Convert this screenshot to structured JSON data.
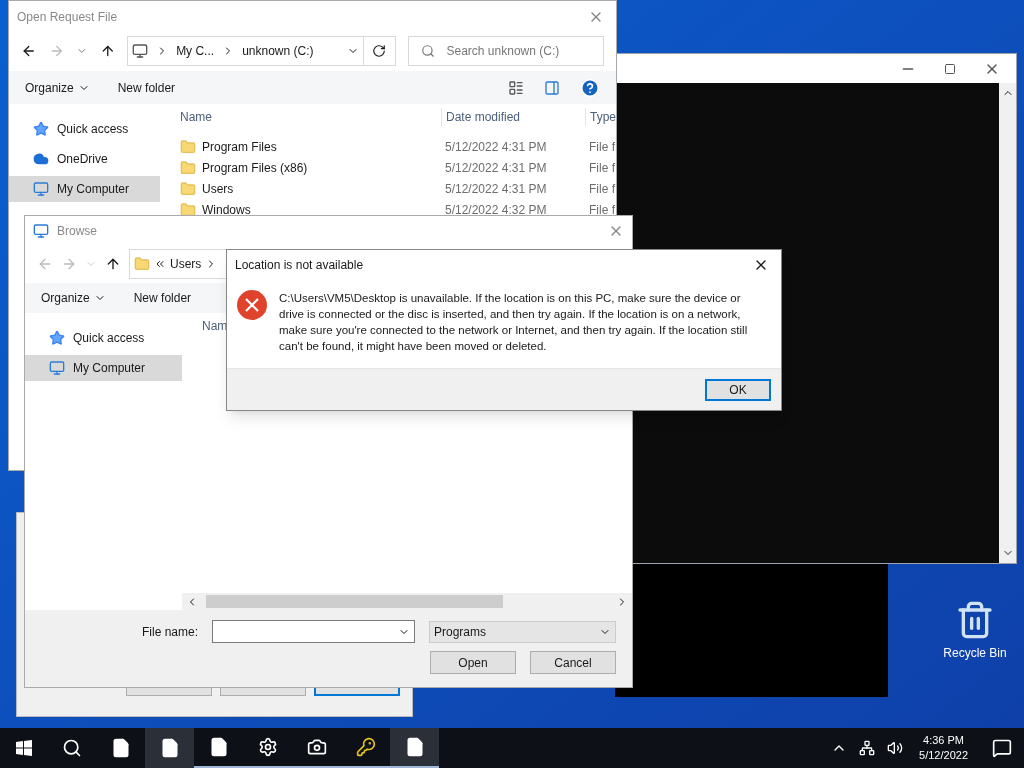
{
  "open_request_window": {
    "title": "Open Request File",
    "breadcrumb": [
      "My C...",
      "unknown (C:)"
    ],
    "search_placeholder": "Search unknown (C:)",
    "toolbar": [
      "Organize",
      "New folder"
    ],
    "sidebar": [
      {
        "label": "Quick access",
        "kind": "star",
        "selected": false
      },
      {
        "label": "OneDrive",
        "kind": "cloud",
        "selected": false
      },
      {
        "label": "My Computer",
        "kind": "computer",
        "selected": true
      }
    ],
    "columns": [
      "Name",
      "Date modified",
      "Type"
    ],
    "rows": [
      {
        "name": "Program Files",
        "date": "5/12/2022 4:31 PM",
        "type": "File f"
      },
      {
        "name": "Program Files (x86)",
        "date": "5/12/2022 4:31 PM",
        "type": "File f"
      },
      {
        "name": "Users",
        "date": "5/12/2022 4:31 PM",
        "type": "File f"
      },
      {
        "name": "Windows",
        "date": "5/12/2022 4:32 PM",
        "type": "File f"
      }
    ]
  },
  "back_dialog": {
    "buttons": [
      {
        "focused": false
      },
      {
        "focused": false
      },
      {
        "focused": true
      }
    ]
  },
  "browse_window": {
    "title": "Browse",
    "breadcrumb": [
      "Users"
    ],
    "toolbar": [
      "Organize",
      "New folder"
    ],
    "sidebar": [
      {
        "label": "Quick access",
        "kind": "star",
        "selected": false
      },
      {
        "label": "My Computer",
        "kind": "computer",
        "selected": true
      }
    ],
    "columns": [
      "Nam"
    ],
    "file_name_label": "File name:",
    "file_type": "Programs",
    "buttons": [
      "Open",
      "Cancel"
    ]
  },
  "error_dialog": {
    "title": "Location is not available",
    "message": "C:\\Users\\VM5\\Desktop is unavailable. If the location is on this PC, make sure the device or drive is connected or the disc is inserted, and then try again. If the location is on a network, make sure you're connected to the network or Internet, and then try again. If the location still can't be found, it might have been moved or deleted.",
    "button": "OK"
  },
  "desktop_icons": [
    {
      "label": "Recycle Bin"
    }
  ],
  "taskbar": {
    "apps": [
      {
        "kind": "file",
        "active": false,
        "running": false
      },
      {
        "kind": "file",
        "active": true,
        "running": false
      },
      {
        "kind": "file",
        "active": false,
        "running": true
      },
      {
        "kind": "settings",
        "active": false,
        "running": true
      },
      {
        "kind": "camera",
        "active": false,
        "running": true
      },
      {
        "kind": "keys",
        "active": false,
        "running": true
      },
      {
        "kind": "file",
        "active": true,
        "running": true
      }
    ],
    "time": "4:36 PM",
    "date": "5/12/2022"
  }
}
